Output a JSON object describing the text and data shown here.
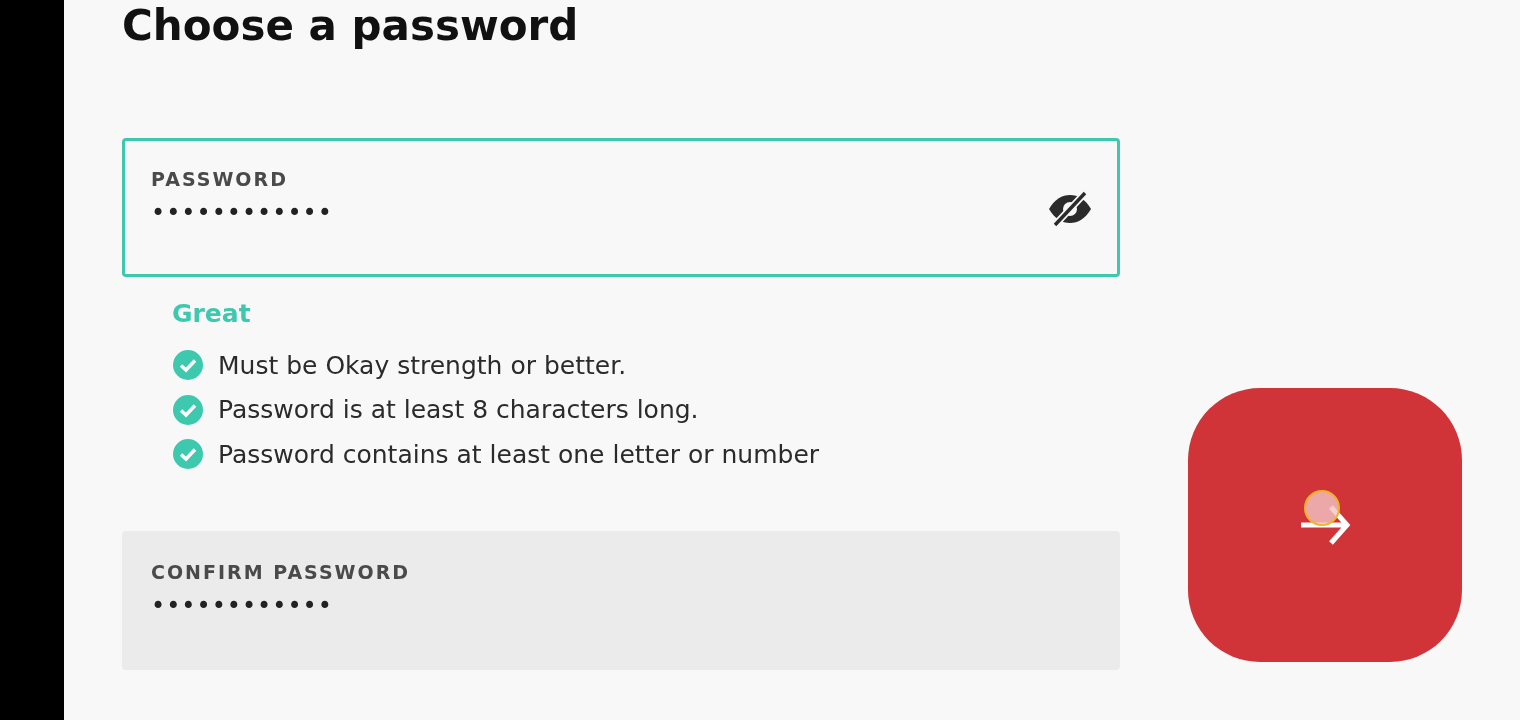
{
  "title": "Choose a password",
  "password": {
    "label": "PASSWORD",
    "value": "••••••••••••",
    "focused": true,
    "masked": true
  },
  "strength": "Great",
  "rules": [
    {
      "text": "Must be Okay strength or better.",
      "met": true
    },
    {
      "text": "Password is at least 8 characters long.",
      "met": true
    },
    {
      "text": "Password contains at least one letter or number",
      "met": true
    }
  ],
  "confirm_password": {
    "label": "CONFIRM PASSWORD",
    "value": "••••••••••••",
    "focused": false
  }
}
